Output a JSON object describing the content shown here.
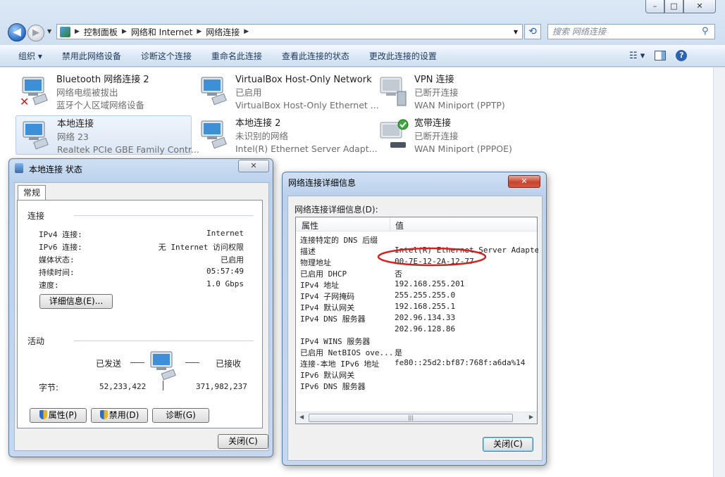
{
  "explorer": {
    "caption_buttons": [
      "–",
      "□",
      "✕"
    ],
    "breadcrumbs": [
      "控制面板",
      "网络和 Internet",
      "网络连接"
    ],
    "search_placeholder": "搜索 网络连接",
    "toolbar": [
      "组织 ▾",
      "禁用此网络设备",
      "诊断这个连接",
      "重命名此连接",
      "查看此连接的状态",
      "更改此连接的设置"
    ],
    "connections": [
      {
        "name": "Bluetooth 网络连接 2",
        "status": "网络电缆被拔出",
        "device": "蓝牙个人区域网络设备",
        "icon": "network-adapter-disconnected-icon"
      },
      {
        "name": "VirtualBox Host-Only Network",
        "status": "已启用",
        "device": "VirtualBox Host-Only Ethernet ...",
        "icon": "network-adapter-icon"
      },
      {
        "name": "VPN 连接",
        "status": "已断开连接",
        "device": "WAN Miniport (PPTP)",
        "icon": "vpn-icon"
      },
      {
        "name": "本地连接",
        "status": "网络  23",
        "device": "Realtek PCIe GBE Family Contr...",
        "icon": "network-adapter-icon"
      },
      {
        "name": "本地连接 2",
        "status": "未识别的网络",
        "device": "Intel(R) Ethernet Server Adapt...",
        "icon": "network-adapter-icon"
      },
      {
        "name": "宽带连接",
        "status": "已断开连接",
        "device": "WAN Miniport (PPPOE)",
        "icon": "broadband-icon"
      }
    ]
  },
  "status_dialog": {
    "title": "本地连接 状态",
    "tab": "常规",
    "section_connection": "连接",
    "rows": [
      {
        "label": "IPv4 连接:",
        "value": "Internet"
      },
      {
        "label": "IPv6 连接:",
        "value": "无 Internet 访问权限"
      },
      {
        "label": "媒体状态:",
        "value": "已启用"
      },
      {
        "label": "持续时间:",
        "value": "05:57:49"
      },
      {
        "label": "速度:",
        "value": "1.0 Gbps"
      }
    ],
    "details_button": "详细信息(E)...",
    "section_activity": "活动",
    "sent_label": "已发送",
    "received_label": "已接收",
    "bytes_label": "字节:",
    "bytes_sent": "52,233,422",
    "bytes_received": "371,982,237",
    "properties_button": "属性(P)",
    "disable_button": "禁用(D)",
    "diagnose_button": "诊断(G)",
    "close_button": "关闭(C)"
  },
  "details_dialog": {
    "title": "网络连接详细信息",
    "caption": "网络连接详细信息(D):",
    "col_property": "属性",
    "col_value": "值",
    "rows": [
      {
        "property": "连接特定的 DNS 后缀",
        "value": ""
      },
      {
        "property": "描述",
        "value": "Intel(R) Ethernet Server Adapter"
      },
      {
        "property": "物理地址",
        "value": "00-7E-12-2A-12-77"
      },
      {
        "property": "已启用 DHCP",
        "value": "否"
      },
      {
        "property": "IPv4 地址",
        "value": "192.168.255.201"
      },
      {
        "property": "IPv4 子网掩码",
        "value": "255.255.255.0"
      },
      {
        "property": "IPv4 默认网关",
        "value": "192.168.255.1"
      },
      {
        "property": "IPv4 DNS 服务器",
        "value": "202.96.134.33"
      },
      {
        "property": "",
        "value": "202.96.128.86"
      },
      {
        "property": "IPv4 WINS 服务器",
        "value": ""
      },
      {
        "property": "已启用 NetBIOS ove...",
        "value": "是"
      },
      {
        "property": "连接-本地 IPv6 地址",
        "value": "fe80::25d2:bf87:768f:a6da%14"
      },
      {
        "property": "IPv6 默认网关",
        "value": ""
      },
      {
        "property": "IPv6 DNS 服务器",
        "value": ""
      }
    ],
    "close_button": "关闭(C)",
    "highlight_color": "#d62020"
  }
}
